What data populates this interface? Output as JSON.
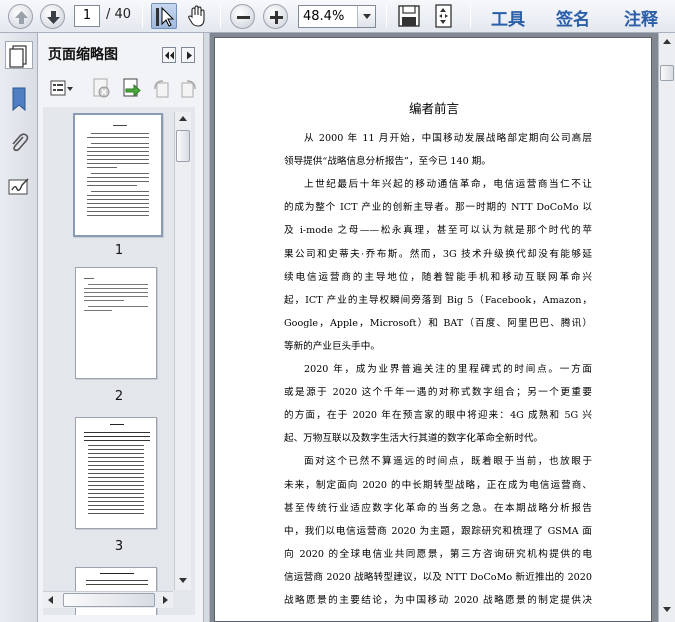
{
  "toolbar": {
    "current_page": "1",
    "page_total": "/ 40",
    "zoom": "48.4%",
    "menu": {
      "tools": "工具",
      "sign": "签名",
      "comment": "注释"
    },
    "icons": [
      "up-arrow-icon",
      "down-arrow-icon",
      "select-cursor-icon",
      "hand-icon",
      "zoom-out-icon",
      "zoom-in-icon",
      "save-icon",
      "fit-page-icon"
    ]
  },
  "sidebar": {
    "icons": [
      "bookmark-icon",
      "attachment-icon",
      "signature-icon"
    ]
  },
  "thumbnails": {
    "title": "页面缩略图",
    "toolbar_icons": [
      "options-icon",
      "delete-page-icon",
      "insert-page-icon",
      "rotate-ccw-icon",
      "rotate-cw-icon"
    ],
    "pages": [
      {
        "number": "1"
      },
      {
        "number": "2"
      },
      {
        "number": "3"
      }
    ]
  },
  "document": {
    "title": "编者前言",
    "lines": [
      "从 2000 年 11 月开始，中国移动发展战略部定期向公司高层",
      "领导提供“战略信息分析报告”，至今已 140 期。",
      "上世纪最后十年兴起的移动通信革命，电信运营商当仁不让",
      "的成为整个 ICT 产业的创新主导者。那一时期的 NTT DoCoMo 以",
      "及 i-mode 之母——松永真理，甚至可以认为就是那个时代的苹",
      "果公司和史蒂夫·乔布斯。然而，3G 技术升级换代却没有能够延",
      "续电信运营商的主导地位，随着智能手机和移动互联网革命兴",
      "起，ICT 产业的主导权瞬间旁落到 Big 5（Facebook，Amazon，",
      "Google，Apple，Microsoft）和 BAT（百度、阿里巴巴、腾讯）",
      "等新的产业巨头手中。",
      "2020 年，成为业界普遍关注的里程碑式的时间点。一方面",
      "或是源于 2020 这个千年一遇的对称式数字组合；另一个更重要",
      "的方面，在于 2020 年在预言家的眼中将迎来：4G 成熟和 5G 兴",
      "起、万物互联以及数字生活大行其道的数字化革命全新时代。",
      "面对这个已然不算遥远的时间点，既着眼于当前，也放眼于",
      "未来，制定面向 2020 的中长期转型战略，正在成为电信运营商、",
      "甚至传统行业适应数字化革命的当务之急。在本期战略分析报告",
      "中，我们以电信运营商 2020 为主题，跟踪研究和梳理了 GSMA 面",
      "向 2020 的全球电信业共同愿景，第三方咨询研究机构提供的电",
      "信运营商 2020 战略转型建议，以及 NTT DoCoMo 新近推出的 2020",
      "战略愿景的主要结论，为中国移动 2020 战略愿景的制定提供决"
    ]
  }
}
